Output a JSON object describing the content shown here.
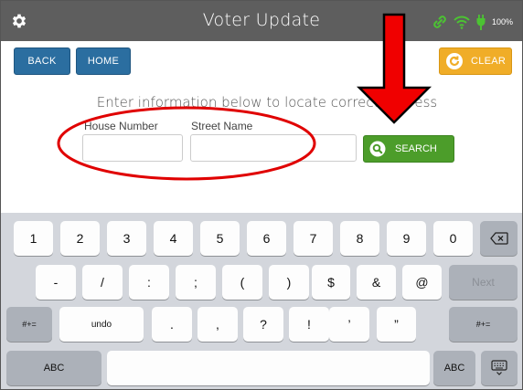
{
  "window": {
    "title": "Voter Update",
    "battery_text": "100%"
  },
  "toolbar": {
    "back_label": "BACK",
    "home_label": "HOME",
    "clear_label": "CLEAR"
  },
  "form": {
    "instruction": "Enter information below to locate correct address",
    "house_number_label": "House Number",
    "street_name_label": "Street Name",
    "house_number_value": "",
    "street_name_value": "",
    "search_label": "SEARCH"
  },
  "keyboard": {
    "row1": [
      "1",
      "2",
      "3",
      "4",
      "5",
      "6",
      "7",
      "8",
      "9",
      "0"
    ],
    "row2": [
      "-",
      "/",
      ":",
      ";",
      "(",
      ")",
      "$",
      "&",
      "@"
    ],
    "next_label": "Next",
    "row3_left": "#+=",
    "undo_label": "undo",
    "row3": [
      ".",
      ",",
      "?",
      "!",
      "’",
      "”"
    ],
    "row3_right": "#+=",
    "abc_left": "ABC",
    "abc_right": "ABC"
  },
  "colors": {
    "titlebar": "#5e5e5e",
    "primary_button": "#2b6ea0",
    "clear_button": "#f0ad28",
    "search_button": "#4c9d2a",
    "annotation_red": "#e00000"
  }
}
